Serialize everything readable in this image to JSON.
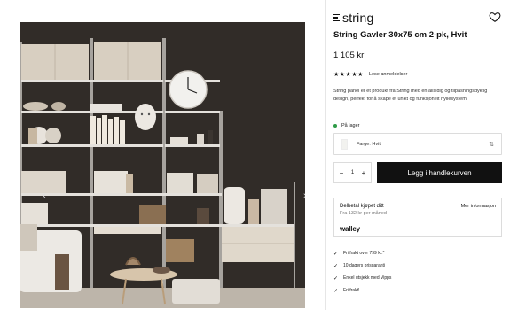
{
  "brand": {
    "name": "string"
  },
  "product": {
    "title": "String Gavler 30x75 cm 2-pk, Hvit",
    "price": "1 105 kr",
    "stars": "★★★★★",
    "reviews_label": "Lese anmeldelser",
    "description": "String panel er et produkt fra String med en allsidig og tilpasningsdyktig design, perfekt for å skape et unikt og funksjonelt hyllesystem.",
    "stock_status": "På lager",
    "color_label": "Farge: Hvit",
    "quantity": "1",
    "add_to_cart_label": "Legg i handlekurven",
    "qty_minus": "−",
    "qty_plus": "+"
  },
  "financing": {
    "title": "Delbetal kjøpet ditt",
    "subtitle": "Fra 132 kr per måned",
    "info_link": "Mer informasjon",
    "provider": "walley"
  },
  "usps": [
    "Fri frakt over 799 kr.*",
    "10 dagers prisgaranti",
    "Enkel utsjekk med Vipps",
    "Fri frakt!"
  ],
  "gallery": {
    "prev": "‹",
    "next": "›"
  },
  "colors": {
    "accent": "#111111",
    "stock": "#2e9b47",
    "wall": "#2e2a26"
  },
  "icons": [
    "heart-icon",
    "chevron-left-icon",
    "chevron-right-icon",
    "swap-arrows-icon",
    "check-icon"
  ]
}
